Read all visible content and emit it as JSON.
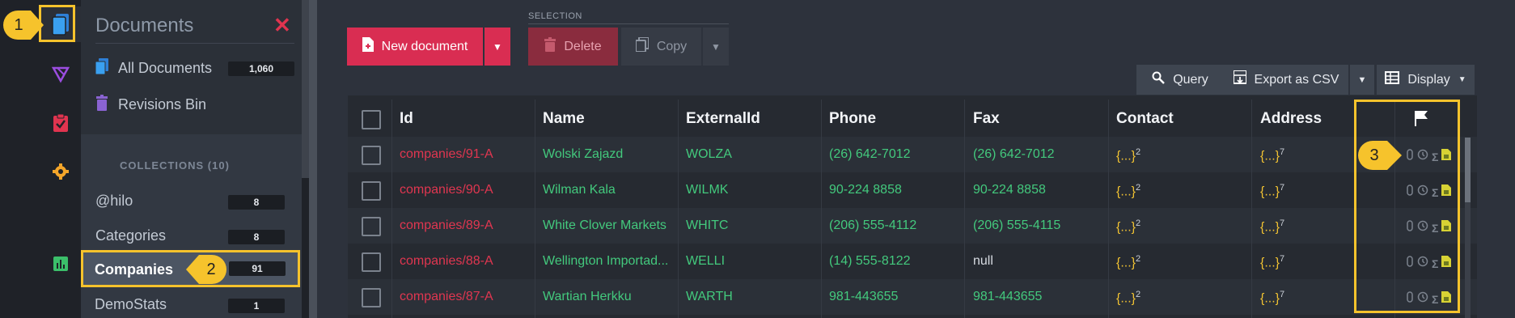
{
  "panel": {
    "title": "Documents",
    "nav": [
      {
        "label": "All Documents",
        "count": "1,060"
      },
      {
        "label": "Revisions Bin"
      }
    ],
    "collections_header": "COLLECTIONS (10)",
    "collections": [
      {
        "label": "@hilo",
        "count": "8"
      },
      {
        "label": "Categories",
        "count": "8"
      },
      {
        "label": "Companies",
        "count": "91"
      },
      {
        "label": "DemoStats",
        "count": "1"
      }
    ]
  },
  "toolbar": {
    "new_document": "New document",
    "selection_label": "SELECTION",
    "delete": "Delete",
    "copy": "Copy",
    "query": "Query",
    "export_csv": "Export as CSV",
    "display": "Display"
  },
  "table": {
    "headers": [
      "Id",
      "Name",
      "ExternalId",
      "Phone",
      "Fax",
      "Contact",
      "Address"
    ],
    "rows": [
      {
        "id": "companies/91-A",
        "name": "Wolski Zajazd",
        "external_id": "WOLZA",
        "phone": "(26) 642-7012",
        "fax": "(26) 642-7012",
        "contact": "{...}",
        "contact_count": "2",
        "address": "{...}",
        "address_count": "7"
      },
      {
        "id": "companies/90-A",
        "name": "Wilman Kala",
        "external_id": "WILMK",
        "phone": "90-224 8858",
        "fax": "90-224 8858",
        "contact": "{...}",
        "contact_count": "2",
        "address": "{...}",
        "address_count": "7"
      },
      {
        "id": "companies/89-A",
        "name": "White Clover Markets",
        "external_id": "WHITC",
        "phone": "(206) 555-4112",
        "fax": "(206) 555-4115",
        "contact": "{...}",
        "contact_count": "2",
        "address": "{...}",
        "address_count": "7"
      },
      {
        "id": "companies/88-A",
        "name": "Wellington Importad...",
        "external_id": "WELLI",
        "phone": "(14) 555-8122",
        "fax": "null",
        "contact": "{...}",
        "contact_count": "2",
        "address": "{...}",
        "address_count": "7"
      },
      {
        "id": "companies/87-A",
        "name": "Wartian Herkku",
        "external_id": "WARTH",
        "phone": "981-443655",
        "fax": "981-443655",
        "contact": "{...}",
        "contact_count": "2",
        "address": "{...}",
        "address_count": "7"
      }
    ]
  },
  "annotations": [
    "1",
    "2",
    "3"
  ],
  "colors": {
    "accent": "#d92d52",
    "highlight": "#f6c32c",
    "id_text": "#e03650",
    "value_text": "#43c97d",
    "object_text": "#f1c232"
  },
  "icons": {
    "rail": [
      "documents-icon",
      "indexes-icon",
      "tasks-icon",
      "settings-icon",
      "stats-icon"
    ],
    "row": [
      "attachment-icon",
      "revisions-icon",
      "counters-icon",
      "time-series-icon"
    ]
  }
}
